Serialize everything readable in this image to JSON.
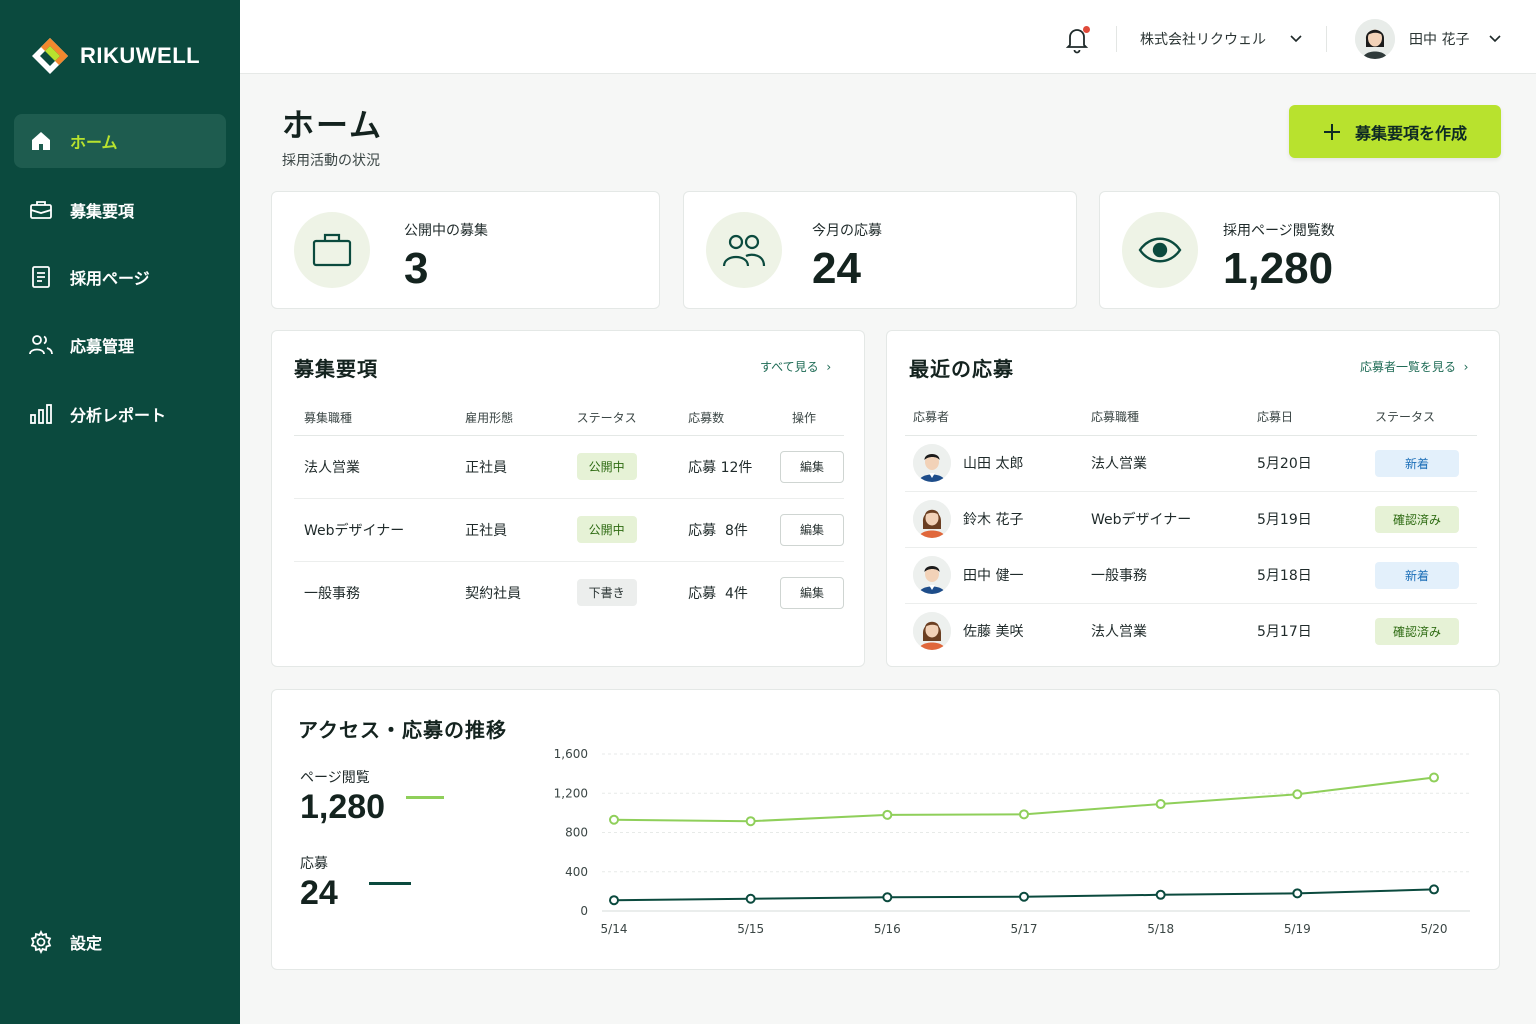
{
  "brand": {
    "name": "RIKUWELL"
  },
  "sidebar": {
    "items": [
      {
        "label": "ホーム",
        "icon": "home-icon"
      },
      {
        "label": "募集要項",
        "icon": "briefcase-icon"
      },
      {
        "label": "採用ページ",
        "icon": "document-icon"
      },
      {
        "label": "応募管理",
        "icon": "users-icon"
      },
      {
        "label": "分析レポート",
        "icon": "bar-chart-icon"
      }
    ],
    "settings_label": "設定"
  },
  "topbar": {
    "company": "株式会社リクウェル",
    "user_name": "田中 花子"
  },
  "header": {
    "title": "ホーム",
    "subtitle": "採用活動の状況",
    "create_button": "募集要項を作成"
  },
  "stats": [
    {
      "label": "公開中の募集",
      "value": "3",
      "icon": "briefcase-icon"
    },
    {
      "label": "今月の応募",
      "value": "24",
      "icon": "users-icon"
    },
    {
      "label": "採用ページ閲覧数",
      "value": "1,280",
      "icon": "eye-icon"
    }
  ],
  "jobs": {
    "title": "募集要項",
    "see_all": "すべて見る",
    "columns": [
      "募集職種",
      "雇用形態",
      "ステータス",
      "応募数",
      "操作"
    ],
    "rows": [
      {
        "role": "法人営業",
        "type": "正社員",
        "status": "公開中",
        "status_kind": "open",
        "count": "応募 12件",
        "action": "編集"
      },
      {
        "role": "Webデザイナー",
        "type": "正社員",
        "status": "公開中",
        "status_kind": "open",
        "count": "応募  8件",
        "action": "編集"
      },
      {
        "role": "一般事務",
        "type": "契約社員",
        "status": "下書き",
        "status_kind": "draft",
        "count": "応募  4件",
        "action": "編集"
      }
    ]
  },
  "applications": {
    "title": "最近の応募",
    "see_all": "応募者一覧を見る",
    "columns": [
      "応募者",
      "応募職種",
      "応募日",
      "ステータス"
    ],
    "rows": [
      {
        "name": "山田 太郎",
        "role": "法人営業",
        "date": "5月20日",
        "status": "新着",
        "status_kind": "new",
        "gender": "m"
      },
      {
        "name": "鈴木 花子",
        "role": "Webデザイナー",
        "date": "5月19日",
        "status": "確認済み",
        "status_kind": "seen",
        "gender": "f"
      },
      {
        "name": "田中 健一",
        "role": "一般事務",
        "date": "5月18日",
        "status": "新着",
        "status_kind": "new",
        "gender": "m"
      },
      {
        "name": "佐藤 美咲",
        "role": "法人営業",
        "date": "5月17日",
        "status": "確認済み",
        "status_kind": "seen",
        "gender": "f"
      }
    ]
  },
  "trend": {
    "title": "アクセス・応募の推移",
    "legend": [
      {
        "label": "ページ閲覧",
        "value": "1,280",
        "color": "#8fcf5a"
      },
      {
        "label": "応募",
        "value": "24",
        "color": "#0b4a3e"
      }
    ]
  },
  "chart_data": {
    "type": "line",
    "x": [
      "5/14",
      "5/15",
      "5/16",
      "5/17",
      "5/18",
      "5/19",
      "5/20"
    ],
    "series": [
      {
        "name": "ページ閲覧",
        "values": [
          930,
          915,
          980,
          985,
          1090,
          1190,
          1360
        ],
        "color": "#8fcf5a"
      },
      {
        "name": "応募",
        "values": [
          110,
          125,
          140,
          145,
          165,
          180,
          220
        ],
        "color": "#0b4a3e"
      }
    ],
    "ylim": [
      0,
      1600
    ],
    "yticks": [
      "0",
      "400",
      "800",
      "1,200",
      "1,600"
    ],
    "grid": true
  }
}
